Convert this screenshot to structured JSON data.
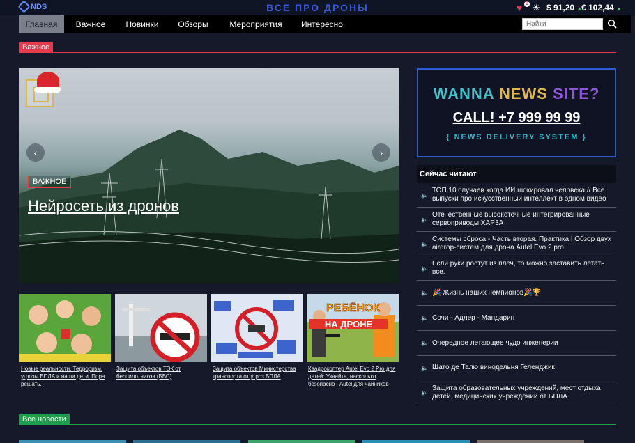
{
  "header": {
    "logo_text": "NDS",
    "site_title": "ВСЕ ПРО ДРОНЫ",
    "fav_count": "0",
    "usd": "$ 91,20",
    "eur": "€ 102,44",
    "icons": [
      "heart-icon",
      "sun-icon",
      "search-icon",
      "speaker-icon"
    ]
  },
  "nav": {
    "items": [
      "Главная",
      "Важное",
      "Новинки",
      "Обзоры",
      "Мероприятия",
      "Интересно"
    ],
    "search_placeholder": "Найти"
  },
  "important": {
    "label": "Важное",
    "hero_badge": "ВАЖНОЕ",
    "hero_title": "Нейросеть из дронов",
    "thumbs": [
      "Новые реальности. Терроризм, угрозы БПЛА и наши дети. Пора решать.",
      "Защита объектов ТЭК от беспилотников (БВС)",
      "Защита объектов Министерства транспорта от угроз БПЛА",
      "Квадрокоптер Autel Evo 2 Pro для детей: Узнайте, насколько безопасно | Autel для чайников"
    ],
    "thumb4_overlay_1": "РЕБЁНОК",
    "thumb4_overlay_2": "НА ДРОНЕ"
  },
  "ad": {
    "line1_a": "WANNA ",
    "line1_b": "NEWS",
    "line1_c": " SITE?",
    "phone": "CALL! +7 999 99 99",
    "tagline": "{ NEWS DELIVERY SYSTEM }"
  },
  "reading": {
    "title": "Сейчас читают",
    "items": [
      "ТОП 10 случаев когда ИИ шокировал человека // Все выпуски про искусственный интеллект в одном видео",
      "Отечественные высокоточные интегрированные сервоприводы ХАРЗА",
      "Системы сброса - Часть вторая. Практика | Обзор двух airdrop-систем для дрона Autel Evo 2 pro",
      "Если руки ростут из плеч, то можно заставить летать все.",
      "🎉 Жизнь наших чемпионов🎉🏆",
      "Сочи - Адлер - Мандарин",
      "Очередное летающее чудо инженерии",
      "Шато де Талю винодельня Геленджик",
      "Защита образовательных учреждений, мест отдыха детей, медицинских учреждений от БПЛА"
    ]
  },
  "all_news": {
    "label": "Все новости"
  },
  "colors": {
    "accent_red": "#e33b4b",
    "accent_green": "#1e9e4a",
    "bg": "#15192a"
  }
}
